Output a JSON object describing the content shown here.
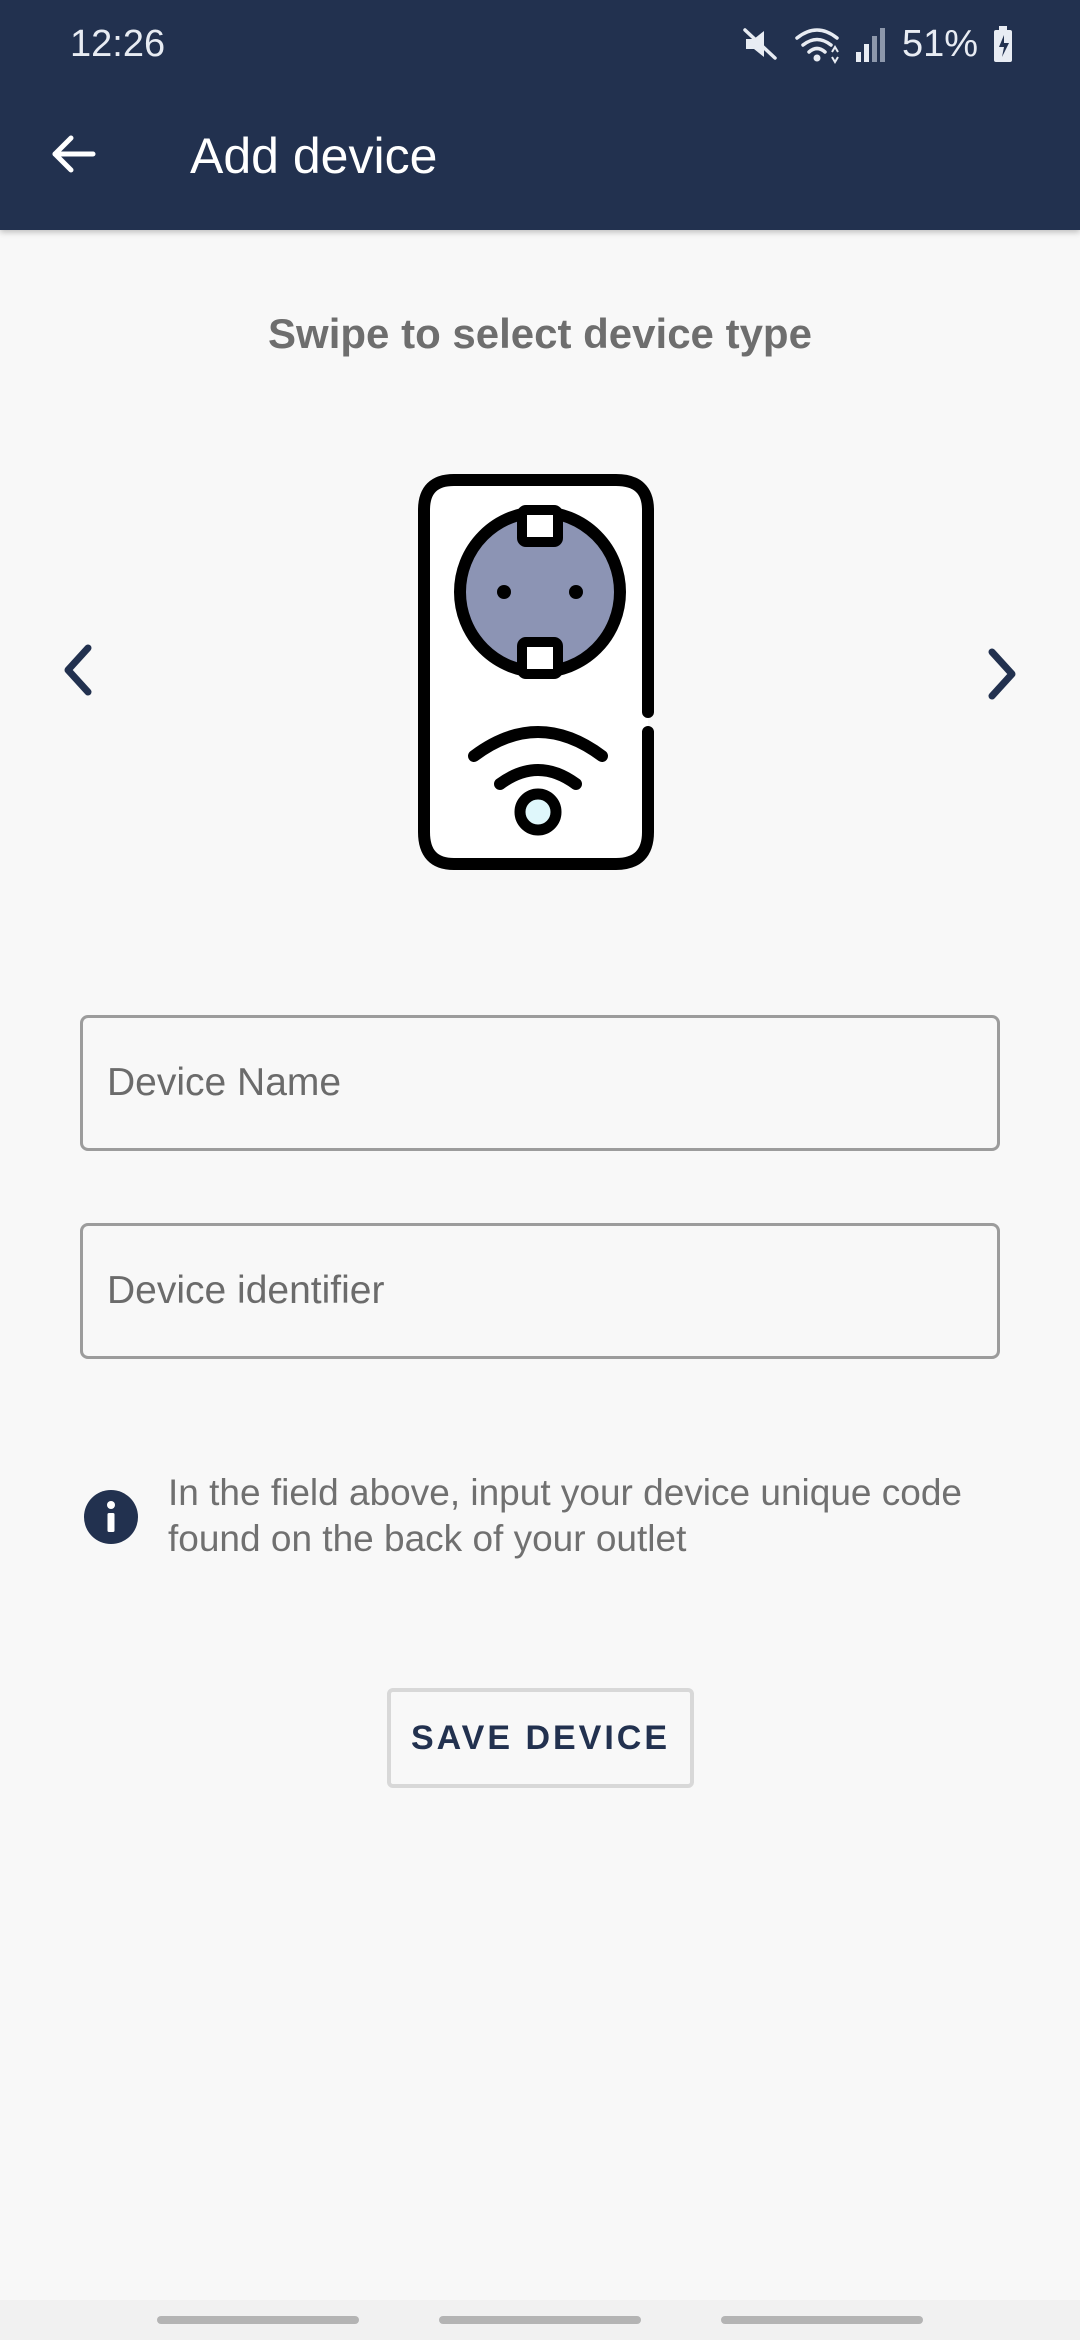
{
  "status_bar": {
    "time": "12:26",
    "battery_percent": "51%",
    "icons": [
      "mute-icon",
      "wifi-icon",
      "signal-icon",
      "battery-icon"
    ]
  },
  "app_bar": {
    "title": "Add device",
    "back_icon": "arrow-left-icon",
    "background_color": "#22314f"
  },
  "device_selector": {
    "instruction": "Swipe to select device type",
    "prev_icon": "chevron-left-icon",
    "next_icon": "chevron-right-icon",
    "device_icon": "smart-plug-icon",
    "socket_color": "#8c94b4"
  },
  "form": {
    "device_name": {
      "placeholder": "Device Name",
      "value": ""
    },
    "device_identifier": {
      "placeholder": "Device identifier",
      "value": ""
    }
  },
  "info": {
    "icon": "info-icon",
    "text": "In the field above, input your device unique code found on the back of your outlet"
  },
  "actions": {
    "save_label": "SAVE DEVICE"
  },
  "colors": {
    "primary": "#22314f",
    "background": "#f8f8f8",
    "muted_text": "#707070"
  }
}
